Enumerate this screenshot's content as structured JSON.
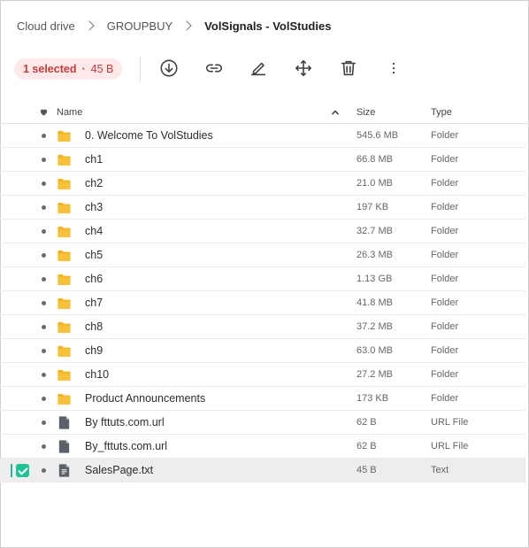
{
  "breadcrumb": {
    "root": "Cloud drive",
    "parent": "GROUPBUY",
    "current": "VolSignals - VolStudies"
  },
  "selection": {
    "count_label": "1 selected",
    "separator": "·",
    "size": "45 B"
  },
  "toolbar": {
    "icons": [
      "download-icon",
      "link-icon",
      "rename-icon",
      "move-icon",
      "delete-icon",
      "more-icon"
    ]
  },
  "columns": {
    "name": "Name",
    "size": "Size",
    "type": "Type"
  },
  "colors": {
    "folder": "#f8b21a",
    "selection_badge_bg": "#fde9e9",
    "selection_badge_text": "#c73a3a",
    "checkbox": "#1ec396",
    "selected_row": "#ededed"
  },
  "rows": [
    {
      "name": "0. Welcome To VolStudies",
      "size": "545.6 MB",
      "type": "Folder",
      "icon": "folder-icon",
      "selected": false
    },
    {
      "name": "ch1",
      "size": "66.8 MB",
      "type": "Folder",
      "icon": "folder-icon",
      "selected": false
    },
    {
      "name": "ch2",
      "size": "21.0 MB",
      "type": "Folder",
      "icon": "folder-icon",
      "selected": false
    },
    {
      "name": "ch3",
      "size": "197 KB",
      "type": "Folder",
      "icon": "folder-icon",
      "selected": false
    },
    {
      "name": "ch4",
      "size": "32.7 MB",
      "type": "Folder",
      "icon": "folder-icon",
      "selected": false
    },
    {
      "name": "ch5",
      "size": "26.3 MB",
      "type": "Folder",
      "icon": "folder-icon",
      "selected": false
    },
    {
      "name": "ch6",
      "size": "1.13 GB",
      "type": "Folder",
      "icon": "folder-icon",
      "selected": false
    },
    {
      "name": "ch7",
      "size": "41.8 MB",
      "type": "Folder",
      "icon": "folder-icon",
      "selected": false
    },
    {
      "name": "ch8",
      "size": "37.2 MB",
      "type": "Folder",
      "icon": "folder-icon",
      "selected": false
    },
    {
      "name": "ch9",
      "size": "63.0 MB",
      "type": "Folder",
      "icon": "folder-icon",
      "selected": false
    },
    {
      "name": "ch10",
      "size": "27.2 MB",
      "type": "Folder",
      "icon": "folder-icon",
      "selected": false
    },
    {
      "name": "Product Announcements",
      "size": "173 KB",
      "type": "Folder",
      "icon": "folder-icon",
      "selected": false
    },
    {
      "name": "By fttuts.com.url",
      "size": "62 B",
      "type": "URL File",
      "icon": "url-file-icon",
      "selected": false
    },
    {
      "name": "By_fttuts.com.url",
      "size": "62 B",
      "type": "URL File",
      "icon": "url-file-icon",
      "selected": false
    },
    {
      "name": "SalesPage.txt",
      "size": "45 B",
      "type": "Text",
      "icon": "text-file-icon",
      "selected": true
    }
  ]
}
